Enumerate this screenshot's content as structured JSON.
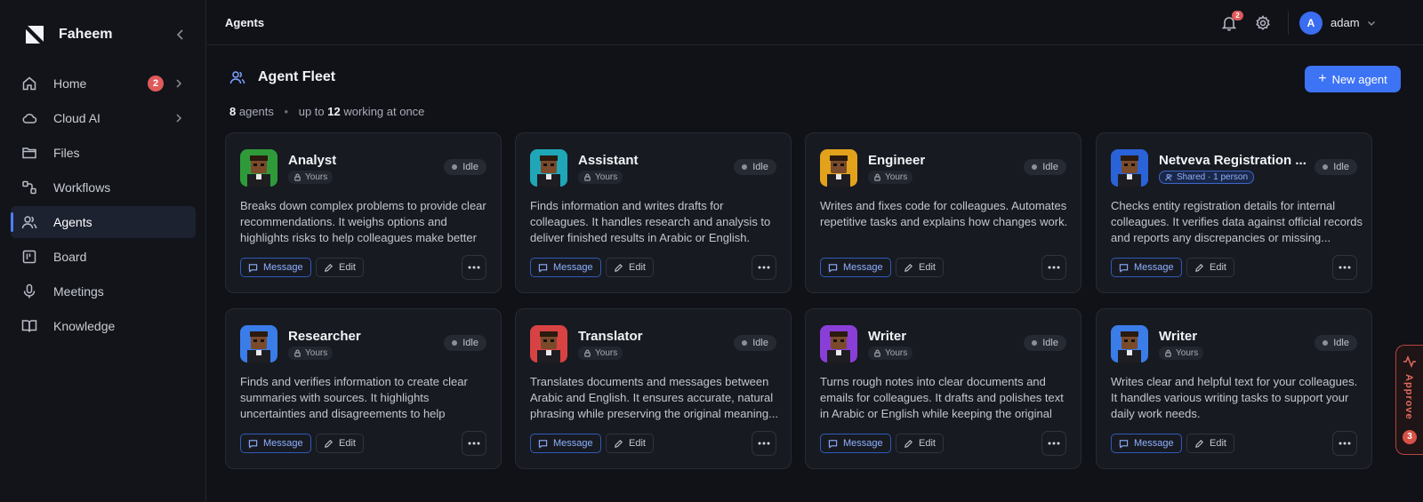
{
  "app": {
    "name": "Faheem"
  },
  "sidebar": {
    "items": [
      {
        "label": "Home",
        "badge": "2",
        "icon": "home-icon"
      },
      {
        "label": "Cloud AI",
        "icon": "cloud-icon"
      },
      {
        "label": "Files",
        "icon": "folder-icon"
      },
      {
        "label": "Workflows",
        "icon": "workflow-icon"
      },
      {
        "label": "Agents",
        "icon": "users-icon",
        "active": true
      },
      {
        "label": "Board",
        "icon": "board-icon"
      },
      {
        "label": "Meetings",
        "icon": "microphone-icon"
      },
      {
        "label": "Knowledge",
        "icon": "book-icon"
      }
    ]
  },
  "topbar": {
    "title": "Agents",
    "notifications": "2",
    "user_initial": "A",
    "username": "adam"
  },
  "fleet": {
    "title": "Agent Fleet",
    "agent_count": "8",
    "agents_word": "agents",
    "bullet": "•",
    "up_to": "up to",
    "max_working": "12",
    "working_suffix": "working at once",
    "new_agent_label": "New agent"
  },
  "cards": [
    {
      "name": "Analyst",
      "owner": "Yours",
      "status": "Idle",
      "avatar_bg": "#2f9a3a",
      "desc": "Breaks down complex problems to provide clear recommendations. It weighs options and highlights risks to help colleagues make better decisions."
    },
    {
      "name": "Assistant",
      "owner": "Yours",
      "status": "Idle",
      "avatar_bg": "#1fa7b8",
      "desc": "Finds information and writes drafts for colleagues. It handles research and analysis to deliver finished results in Arabic or English."
    },
    {
      "name": "Engineer",
      "owner": "Yours",
      "status": "Idle",
      "avatar_bg": "#e3a21c",
      "desc": "Writes and fixes code for colleagues. Automates repetitive tasks and explains how changes work."
    },
    {
      "name": "Netveva Registration ...",
      "owner": "Shared · 1 person",
      "status": "Idle",
      "avatar_bg": "#2a62d8",
      "desc": "Checks entity registration details for internal colleagues. It verifies data against official records and reports any discrepancies or missing..."
    },
    {
      "name": "Researcher",
      "owner": "Yours",
      "status": "Idle",
      "avatar_bg": "#3a7ce8",
      "desc": "Finds and verifies information to create clear summaries with sources. It highlights uncertainties and disagreements to help colleagues make..."
    },
    {
      "name": "Translator",
      "owner": "Yours",
      "status": "Idle",
      "avatar_bg": "#d84242",
      "desc": "Translates documents and messages between Arabic and English. It ensures accurate, natural phrasing while preserving the original meaning..."
    },
    {
      "name": "Writer",
      "owner": "Yours",
      "status": "Idle",
      "avatar_bg": "#8a3ed8",
      "desc": "Turns rough notes into clear documents and emails for colleagues. It drafts and polishes text in Arabic or English while keeping the original meaning..."
    },
    {
      "name": "Writer",
      "owner": "Yours",
      "status": "Idle",
      "avatar_bg": "#3a7ce8",
      "desc": "Writes clear and helpful text for your colleagues. It handles various writing tasks to support your daily work needs."
    }
  ],
  "card_actions": {
    "message": "Message",
    "edit": "Edit"
  },
  "approve": {
    "label": "Approve",
    "count": "3"
  },
  "colors": {
    "accent": "#3d73f5",
    "badge": "#e05a5a",
    "approve": "#e36a5e"
  }
}
